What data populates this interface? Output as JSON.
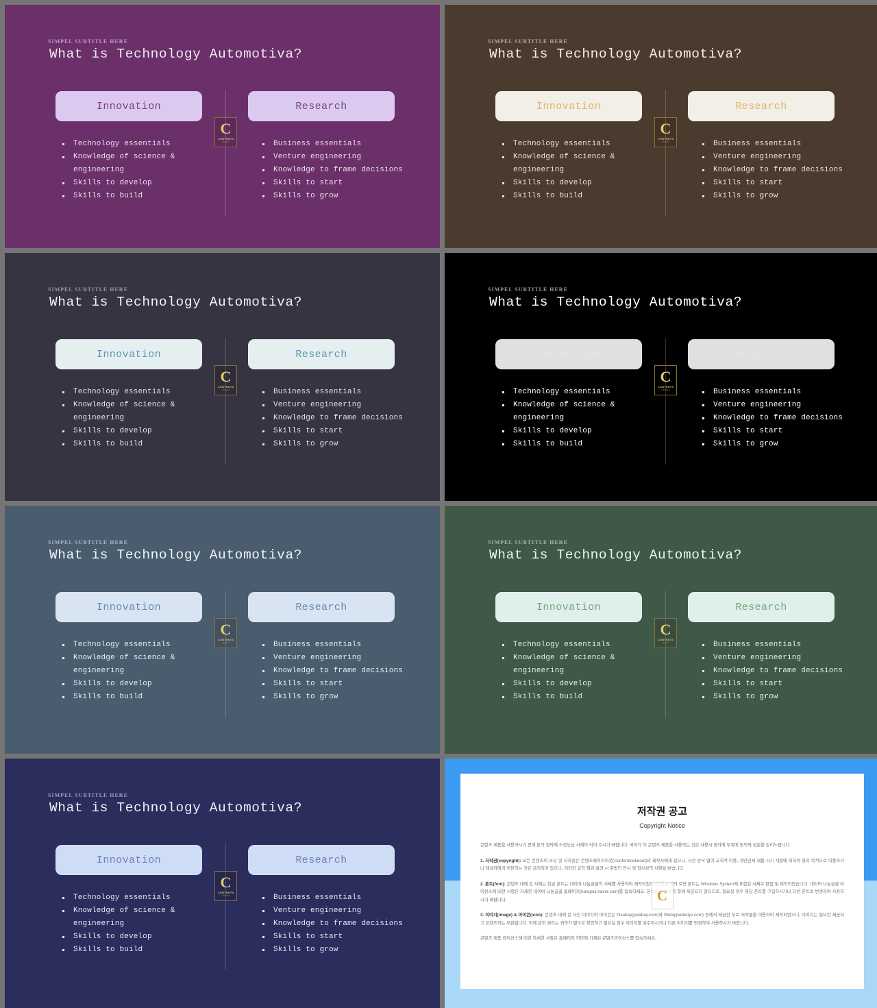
{
  "deck": {
    "subtitle": "SIMPEL SUBTITLE HERE",
    "title": "What is Technology Automotiva?",
    "logo": {
      "letter": "C",
      "word": "CONTENTS",
      "sub": "LIBRARY"
    },
    "cards": {
      "left_label": "Innovation",
      "right_label": "Research"
    },
    "bullets_left": [
      "Technology essentials",
      "Knowledge of science & engineering",
      "Skills to develop",
      "Skills to build"
    ],
    "bullets_right": [
      "Business essentials",
      "Venture engineering",
      "Knowledge to frame decisions",
      "Skills to start",
      "Skills to grow"
    ]
  },
  "themes": [
    {
      "name": "plum",
      "bg": "#6b2f69",
      "title_color": "#f2eaf2",
      "subtitle_color": "#c39ac2",
      "card_bg": "#dbc9ef",
      "card_text": "#7a3f86",
      "bullet_color": "#ece0ec",
      "divider": "#b69bb6"
    },
    {
      "name": "coffee",
      "bg": "#4b3b2e",
      "title_color": "#f3efe9",
      "subtitle_color": "#b9a893",
      "card_bg": "#f2efe7",
      "card_text": "#e0b46a",
      "bullet_color": "#ece5da",
      "divider": "#a3927e"
    },
    {
      "name": "charcoal",
      "bg": "#363343",
      "title_color": "#f2f2f5",
      "subtitle_color": "#9a95a8",
      "card_bg": "#e6eff0",
      "card_text": "#5a96ad",
      "bullet_color": "#e6e4ec",
      "divider": "#8d88a0"
    },
    {
      "name": "black",
      "bg": "#000000",
      "title_color": "#ffffff",
      "subtitle_color": "#9a9a9a",
      "card_bg": "#e0e0e0",
      "card_text": "#e5e5e5",
      "bullet_color": "#ffffff",
      "divider": "#6e6e6e"
    },
    {
      "name": "steel",
      "bg": "#4a5d6f",
      "title_color": "#f1f4f7",
      "subtitle_color": "#a6b6c4",
      "card_bg": "#d9e4f2",
      "card_text": "#6989ae",
      "bullet_color": "#e8eef4",
      "divider": "#93a4b3"
    },
    {
      "name": "forest",
      "bg": "#3f5848",
      "title_color": "#eff4ef",
      "subtitle_color": "#a3b6a8",
      "card_bg": "#dff0ea",
      "card_text": "#73a57e",
      "bullet_color": "#e7efe8",
      "divider": "#8da497"
    },
    {
      "name": "navy",
      "bg": "#2b2d5c",
      "title_color": "#f0f1f8",
      "subtitle_color": "#9a9cc0",
      "card_bg": "#cfdcf5",
      "card_text": "#6d83b5",
      "bullet_color": "#e4e6f2",
      "divider": "#8284ad"
    }
  ],
  "copyright": {
    "title_ko": "저작권 공고",
    "title_en": "Copyright Notice",
    "intro": "콘텐츠 제품을 사용하시기 전에 본의 협약에 소장능님 사례이 되어 주시기 바랍니다. 귀하가 이 콘텐츠 제품을 사용하는 것은 사용시 생각에 부족에 동의와 성분을 알리노랍니다.",
    "sections": [
      {
        "heading": "1. 저작권(copyright):",
        "text": "모든 콘텐츠의 소유 및 저작권은 콘텐츠메이커의것(Contentstokeout)의 제작사에게 있으니, 사전 승낙 없이 교칙적 이용, 개인인세 제품 사기 개발에 의하여 영리 목적으로 이용하거나 제삼자에게 이용하는 것은 금지되어 있으니, 이러한 교칙 행위 발견 시 준법인 만사 및 형사상의 사항을 받습니다."
      },
      {
        "heading": "2. 폰트(font):",
        "text": "콘텐츠 내에 된 서체는 한글 폰트는 네이버 나눔글꼴의 서체를 사용하여 제작되었으니, 한글 외의 로만 폰트는 Windows System에 포함된 서체로 편집 및 제작되었습니다. 네이버 나눔글꼴 라이선스에 대한 사항은 자세한 네이버 나눔글꼴 홈페이지(hangeul.naver.com)를 접속하세요. 폰트는 콘텐츠와 함께 제공되지 않으므로, 필요실 경우 해당 폰트를 구입하시거나 다른 폰트로 변경하여 사용하시기 바랍니다."
      },
      {
        "heading": "3. 이미지(image) & 아이콘(icon):",
        "text": "콘텐츠 내에 된 사진 이미지와 아이콘은 Pixabay(pixabay.com)와 Webly(webolys.com) 등에서 제공한 무료 저작물을 이용하여 제작되었으니, 이미지는 필요한 제공되고 콘텐츠와는 무관합니다. 이에 관한 권리는 귀하가 별도로 확인하고 필요실 경우 이미지를 위주하시거나 다른 이미지를 변경하여 사용하시기 바랍니다."
      }
    ],
    "footer": "콘텐츠 제품 라이선스에 대한 자세한 사항은 홈페이지 하단에 기재된 콘텐츠라이선스를 접속하세요.",
    "watermark_letter": "C"
  }
}
